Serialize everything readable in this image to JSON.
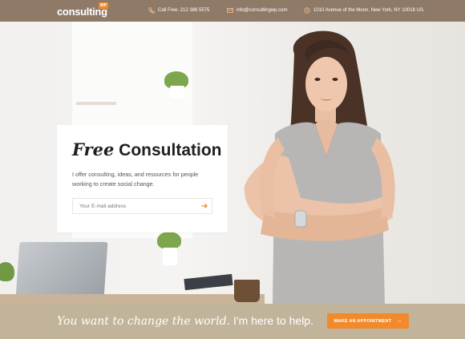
{
  "header": {
    "logo_text": "consulting",
    "logo_badge": "WP",
    "phone": "Call Free: 212 386 5575",
    "email": "info@consultingwp.com",
    "address": "1010 Avenue of the Moon, New York, NY 10018 US."
  },
  "hero_card": {
    "title_italic": "Free",
    "title_regular": "Consultation",
    "description": "I offer consulting, ideas, and resources for people working to create social change.",
    "email_placeholder": "Your E-mail address"
  },
  "bottom_bar": {
    "text_italic": "You want to change the world.",
    "text_regular": "I'm here to help.",
    "cta_label": "MAKE AN APPOINTMENT"
  },
  "colors": {
    "header_bg": "#8f7a68",
    "accent": "#f28a2c",
    "bottom_bg": "#c1b49a"
  },
  "icons": {
    "phone": "phone-icon",
    "email": "envelope-icon",
    "address": "location-pin-icon",
    "submit": "arrow-right-icon"
  }
}
